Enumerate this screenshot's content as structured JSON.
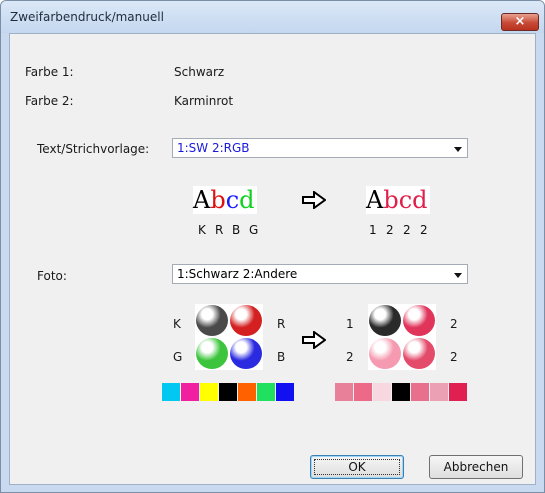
{
  "window": {
    "title": "Zweifarbendruck/manuell",
    "close_glyph": "×"
  },
  "info": {
    "farbe1_label": "Farbe 1:",
    "farbe1_value": "Schwarz",
    "farbe2_label": "Farbe 2:",
    "farbe2_value": "Karminrot"
  },
  "text_section": {
    "label": "Text/Strichvorlage:",
    "select_value": "1:SW 2:RGB",
    "select_color": "#1a1adb",
    "before": {
      "letters": [
        {
          "ch": "A",
          "color": "#000000"
        },
        {
          "ch": "b",
          "color": "#e01010"
        },
        {
          "ch": "c",
          "color": "#1a1aff"
        },
        {
          "ch": "d",
          "color": "#10d020"
        }
      ],
      "codes": [
        "K",
        "R",
        "B",
        "G"
      ]
    },
    "after": {
      "letters": [
        {
          "ch": "A",
          "color": "#000000"
        },
        {
          "ch": "b",
          "color": "#e0204a"
        },
        {
          "ch": "c",
          "color": "#e0204a"
        },
        {
          "ch": "d",
          "color": "#e0204a"
        }
      ],
      "codes": [
        "1",
        "2",
        "2",
        "2"
      ]
    }
  },
  "photo_section": {
    "label": "Foto:",
    "select_value": "1:Schwarz 2:Andere",
    "before_labels": {
      "top_left": "K",
      "top_right": "R",
      "bottom_left": "G",
      "bottom_right": "B"
    },
    "after_labels": {
      "top_left": "1",
      "top_right": "2",
      "bottom_left": "2",
      "bottom_right": "2"
    },
    "before_apples": [
      "#4a4a4a",
      "#d42020",
      "#3cc43c",
      "#2a2ae0"
    ],
    "after_apples": [
      "#2a2a2a",
      "#e0345a",
      "#f59ab0",
      "#e44a6a"
    ],
    "before_swatches": [
      "#00c8f0",
      "#f020a0",
      "#ffff00",
      "#000000",
      "#ff6000",
      "#20e060",
      "#1010f0"
    ],
    "after_swatches": [
      "#e8809a",
      "#ec6a88",
      "#f8d8e0",
      "#000000",
      "#e8708c",
      "#eca0b4",
      "#e02050"
    ]
  },
  "buttons": {
    "ok": "OK",
    "cancel": "Abbrechen"
  },
  "icons": {
    "arrow": "right-arrow-icon"
  }
}
